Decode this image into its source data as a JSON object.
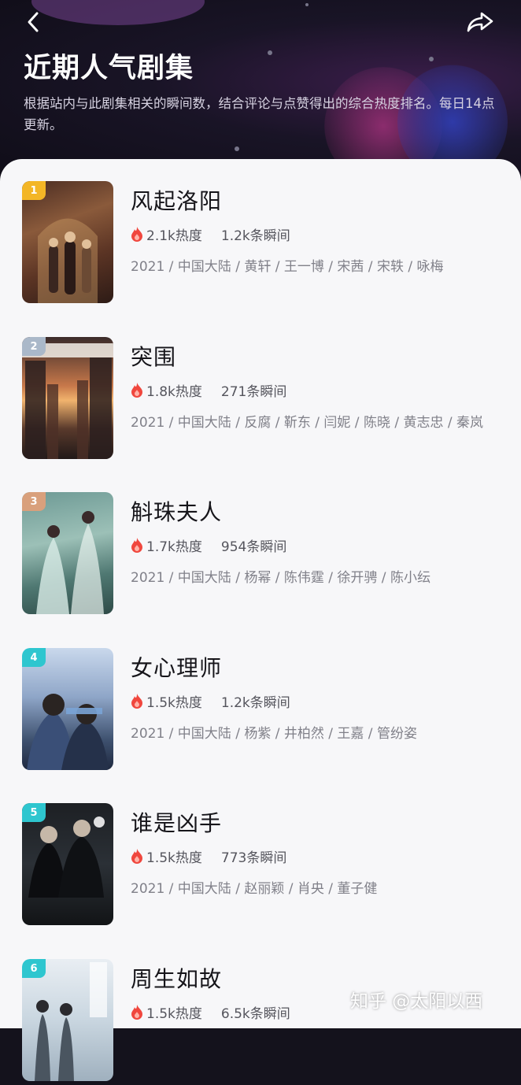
{
  "header": {
    "title": "近期人气剧集",
    "description": "根据站内与此剧集相关的瞬间数，结合评论与点赞得出的综合热度排名。每日14点更新。"
  },
  "colors": {
    "rank_1": "#f3b626",
    "rank_2": "#aab8c9",
    "rank_3": "#d9a07c",
    "rank_other": "#2ec6cf",
    "fire": "#f0473e"
  },
  "items": [
    {
      "rank": "1",
      "title": "风起洛阳",
      "heat": "2.1k热度",
      "moments": "1.2k条瞬间",
      "meta": "2021 / 中国大陆 / 黄轩 / 王一博 / 宋茜 / 宋轶 / 咏梅"
    },
    {
      "rank": "2",
      "title": "突围",
      "heat": "1.8k热度",
      "moments": "271条瞬间",
      "meta": "2021 / 中国大陆 / 反腐 / 靳东 / 闫妮 / 陈晓 / 黄志忠 / 秦岚"
    },
    {
      "rank": "3",
      "title": "斛珠夫人",
      "heat": "1.7k热度",
      "moments": "954条瞬间",
      "meta": "2021 / 中国大陆 / 杨幂 / 陈伟霆 / 徐开骋 / 陈小纭"
    },
    {
      "rank": "4",
      "title": "女心理师",
      "heat": "1.5k热度",
      "moments": "1.2k条瞬间",
      "meta": "2021 / 中国大陆 / 杨紫 / 井柏然 / 王嘉 / 管纷姿"
    },
    {
      "rank": "5",
      "title": "谁是凶手",
      "heat": "1.5k热度",
      "moments": "773条瞬间",
      "meta": "2021 / 中国大陆 / 赵丽颖 / 肖央 / 董子健"
    },
    {
      "rank": "6",
      "title": "周生如故",
      "heat": "1.5k热度",
      "moments": "6.5k条瞬间",
      "meta": ""
    }
  ],
  "watermark": "知乎 @太阳以西"
}
